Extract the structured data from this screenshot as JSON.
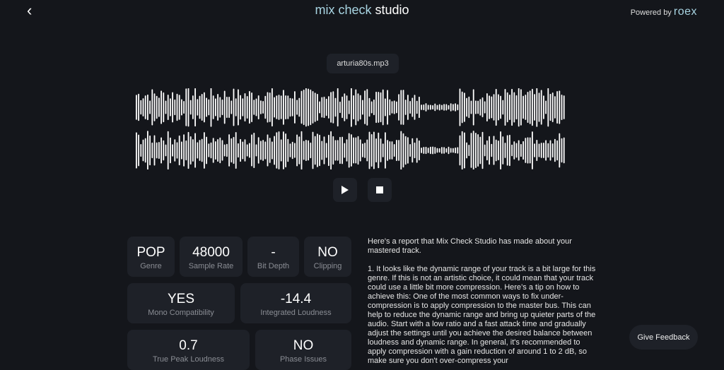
{
  "header": {
    "back_label": "‹",
    "title_a": "mix check",
    "title_b": " studio",
    "powered_by": "Powered by ",
    "brand": "roex"
  },
  "file": {
    "name": "arturia80s.mp3"
  },
  "player": {
    "play_icon": "play-icon",
    "stop_icon": "stop-icon"
  },
  "metrics": [
    {
      "value": "POP",
      "label": "Genre"
    },
    {
      "value": "48000",
      "label": "Sample Rate"
    },
    {
      "value": "-",
      "label": "Bit Depth"
    },
    {
      "value": "NO",
      "label": "Clipping"
    },
    {
      "value": "YES",
      "label": "Mono Compatibility"
    },
    {
      "value": "-14.4",
      "label": "Integrated Loudness"
    },
    {
      "value": "0.7",
      "label": "True Peak Loudness"
    },
    {
      "value": "NO",
      "label": "Phase Issues"
    }
  ],
  "report": {
    "text": "Here's a report that Mix Check Studio has made about your mastered track.\n\n1. It looks like the dynamic range of your track is a bit large for this genre. If this is not an artistic choice, it could mean that your track could use a little bit more compression. Here’s a tip on how to achieve this: One of the most common ways to fix under-compression is to apply compression to the master bus. This can help to reduce the dynamic range and bring up quieter parts of the audio. Start with a low ratio and a fast attack time and gradually adjust the settings until you achieve the desired balance between loudness and dynamic range. In general, it's recommended to apply compression with a gain reduction of around 1 to 2 dB, so make sure you don't over-compress your"
  },
  "feedback": {
    "label": "Give Feedback"
  }
}
